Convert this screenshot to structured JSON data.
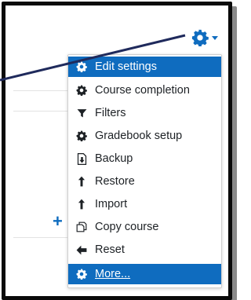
{
  "settings_button": {
    "icon": "gear-icon",
    "caret": "caret-down-icon",
    "color": "#0f6cbf"
  },
  "add_button": {
    "icon": "plus-icon",
    "label": "+"
  },
  "menu": {
    "highlight_color": "#0f6cbf",
    "items": [
      {
        "label": "Edit settings",
        "icon": "gear-icon",
        "active": true
      },
      {
        "label": "Course completion",
        "icon": "gear-icon",
        "active": false
      },
      {
        "label": "Filters",
        "icon": "filter-icon",
        "active": false
      },
      {
        "label": "Gradebook setup",
        "icon": "gear-icon",
        "active": false
      },
      {
        "label": "Backup",
        "icon": "backup-file-icon",
        "active": false
      },
      {
        "label": "Restore",
        "icon": "upload-arrow-icon",
        "active": false
      },
      {
        "label": "Import",
        "icon": "upload-arrow-icon",
        "active": false
      },
      {
        "label": "Copy course",
        "icon": "copy-icon",
        "active": false
      },
      {
        "label": "Reset",
        "icon": "arrow-left-icon",
        "active": false
      },
      {
        "label": "More...",
        "icon": "gear-icon",
        "active": true
      }
    ]
  }
}
